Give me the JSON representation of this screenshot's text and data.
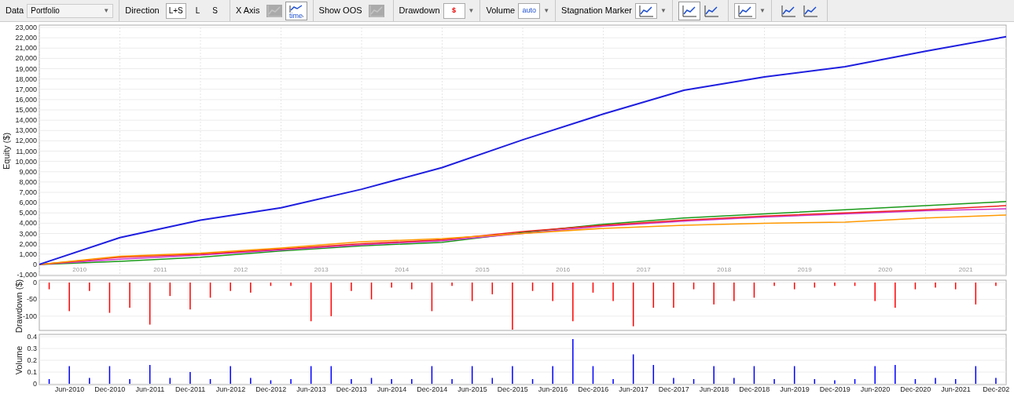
{
  "toolbar": [
    {
      "kind": "select",
      "label": "Data",
      "value": "Portfolio",
      "caret": "▼"
    },
    {
      "kind": "segmented",
      "label": "Direction",
      "options": [
        {
          "label": "L+S",
          "selected": true
        },
        {
          "label": "L",
          "selected": false
        },
        {
          "label": "S",
          "selected": false
        }
      ]
    },
    {
      "kind": "icons",
      "label": "X Axis",
      "buttons": [
        {
          "selected": false,
          "disabled": true
        },
        {
          "selected": true,
          "disabled": false,
          "text": "time"
        }
      ]
    },
    {
      "kind": "icons",
      "label": "Show OOS",
      "buttons": [
        {
          "selected": false,
          "disabled": true
        }
      ]
    },
    {
      "kind": "menu",
      "label": "Drawdown",
      "text": "$",
      "caret": "▼"
    },
    {
      "kind": "menu",
      "label": "Volume",
      "text": "auto",
      "caret": "▼"
    },
    {
      "kind": "menu",
      "label": "Stagnation Marker",
      "caret": "▼"
    },
    {
      "kind": "icons",
      "buttons": [
        {
          "selected": true,
          "disabled": false
        },
        {
          "selected": false,
          "disabled": false
        }
      ]
    },
    {
      "kind": "menu",
      "caret": "▼"
    },
    {
      "kind": "icons",
      "buttons": [
        {
          "selected": false,
          "disabled": false
        },
        {
          "selected": false,
          "disabled": false
        }
      ]
    }
  ],
  "equity": {
    "chart_data": {
      "type": "line",
      "ylabel": "Equity ($)",
      "grid": true,
      "x": [
        2010,
        2011,
        2012,
        2013,
        2014,
        2015,
        2016,
        2017,
        2018,
        2019,
        2020,
        2021,
        2022
      ],
      "xlim": [
        2010,
        2022
      ],
      "ylim": [
        -1000,
        23000
      ],
      "yticks": [
        {
          "value": -1000,
          "label": "-1,000"
        },
        0,
        {
          "value": 1000,
          "label": "1,000"
        },
        {
          "value": 2000,
          "label": "2,000"
        },
        {
          "value": 3000,
          "label": "3,000"
        },
        {
          "value": 4000,
          "label": "4,000"
        },
        {
          "value": 5000,
          "label": "5,000"
        },
        {
          "value": 6000,
          "label": "6,000"
        },
        {
          "value": 7000,
          "label": "7,000"
        },
        {
          "value": 8000,
          "label": "8,000"
        },
        {
          "value": 9000,
          "label": "9,000"
        },
        {
          "value": 10000,
          "label": "10,000"
        },
        {
          "value": 11000,
          "label": "11,000"
        },
        {
          "value": 12000,
          "label": "12,000"
        },
        {
          "value": 13000,
          "label": "13,000"
        },
        {
          "value": 14000,
          "label": "14,000"
        },
        {
          "value": 15000,
          "label": "15,000"
        },
        {
          "value": 16000,
          "label": "16,000"
        },
        {
          "value": 17000,
          "label": "17,000"
        },
        {
          "value": 18000,
          "label": "18,000"
        },
        {
          "value": 19000,
          "label": "19,000"
        },
        {
          "value": 20000,
          "label": "20,000"
        },
        {
          "value": 21000,
          "label": "21,000"
        },
        {
          "value": 22000,
          "label": "22,000"
        },
        {
          "value": 23000,
          "label": "23,000"
        }
      ],
      "xticks": [
        {
          "value": 2010.5,
          "label": "2010"
        },
        {
          "value": 2011.5,
          "label": "2011"
        },
        {
          "value": 2012.5,
          "label": "2012"
        },
        {
          "value": 2013.5,
          "label": "2013"
        },
        {
          "value": 2014.5,
          "label": "2014"
        },
        {
          "value": 2015.5,
          "label": "2015"
        },
        {
          "value": 2016.5,
          "label": "2016"
        },
        {
          "value": 2017.5,
          "label": "2017"
        },
        {
          "value": 2018.5,
          "label": "2018"
        },
        {
          "value": 2019.5,
          "label": "2019"
        },
        {
          "value": 2020.5,
          "label": "2020"
        },
        {
          "value": 2021.5,
          "label": "2021"
        }
      ],
      "series": [
        {
          "color": "#1f1fe0",
          "values": [
            0,
            2600,
            4300,
            5500,
            7300,
            9400,
            12100,
            14600,
            16900,
            18200,
            19200,
            20700,
            22100
          ]
        },
        {
          "color": "#ff9900",
          "values": [
            0,
            800,
            1100,
            1600,
            2200,
            2500,
            3000,
            3500,
            3800,
            4000,
            4100,
            4500,
            4800
          ]
        },
        {
          "color": "#ee2222",
          "values": [
            0,
            700,
            1000,
            1500,
            2000,
            2400,
            3200,
            3800,
            4300,
            4700,
            5000,
            5300,
            5700
          ]
        },
        {
          "color": "#cc33cc",
          "values": [
            0,
            500,
            900,
            1400,
            1900,
            2300,
            3000,
            3700,
            4200,
            4600,
            4900,
            5200,
            5400
          ]
        },
        {
          "color": "#1a9a1a",
          "values": [
            0,
            300,
            700,
            1300,
            1800,
            2150,
            3100,
            3900,
            4500,
            4900,
            5300,
            5700,
            6100
          ]
        }
      ]
    }
  },
  "drawdown": {
    "chart_data": {
      "type": "bar",
      "ylabel": "Drawdown ($)",
      "grid": true,
      "ylim": [
        -140,
        0
      ],
      "yticks": [
        0,
        -50,
        -100
      ],
      "categories": [
        null,
        null,
        null,
        null,
        null,
        null,
        null,
        null,
        null,
        null,
        null,
        null,
        null,
        null,
        null,
        null,
        null,
        null,
        null,
        null,
        null,
        null,
        null,
        null,
        null,
        null,
        null,
        null,
        null,
        null,
        null,
        null,
        null,
        null,
        null,
        null,
        null,
        null,
        null,
        null,
        null,
        null,
        null,
        null,
        null,
        null,
        null,
        null
      ],
      "series": [
        {
          "color": "#ff0000",
          "values": [
            -20,
            -85,
            -25,
            -90,
            -75,
            -125,
            -40,
            -80,
            -45,
            -25,
            -30,
            -10,
            -10,
            -115,
            -100,
            -25,
            -50,
            -15,
            -20,
            -85,
            -10,
            -55,
            -35,
            -140,
            -25,
            -55,
            -115,
            -30,
            -55,
            -130,
            -75,
            -75,
            -20,
            -65,
            -55,
            -45,
            -10,
            -20,
            -15,
            -10,
            -10,
            -55,
            -75,
            -20,
            -15,
            -20,
            -65,
            -10
          ]
        }
      ]
    }
  },
  "volume": {
    "chart_data": {
      "type": "bar",
      "ylabel": "Volume",
      "grid": true,
      "ylim": [
        0,
        0.4
      ],
      "yticks": [
        0,
        0.1,
        0.2,
        0.3,
        0.4
      ],
      "categories": [
        null,
        "Jun-2010",
        null,
        "Dec-2010",
        null,
        "Jun-2011",
        null,
        "Dec-2011",
        null,
        "Jun-2012",
        null,
        "Dec-2012",
        null,
        "Jun-2013",
        null,
        "Dec-2013",
        null,
        "Jun-2014",
        null,
        "Dec-2014",
        null,
        "Jun-2015",
        null,
        "Dec-2015",
        null,
        "Jun-2016",
        null,
        "Dec-2016",
        null,
        "Jun-2017",
        null,
        "Dec-2017",
        null,
        "Jun-2018",
        null,
        "Dec-2018",
        null,
        "Jun-2019",
        null,
        "Dec-2019",
        null,
        "Jun-2020",
        null,
        "Dec-2020",
        null,
        "Jun-2021",
        null,
        "Dec-202"
      ],
      "series": [
        {
          "color": "#0000ff",
          "values": [
            0.04,
            0.15,
            0.05,
            0.15,
            0.04,
            0.16,
            0.05,
            0.1,
            0.04,
            0.15,
            0.05,
            0.03,
            0.04,
            0.15,
            0.15,
            0.04,
            0.05,
            0.04,
            0.04,
            0.15,
            0.04,
            0.15,
            0.05,
            0.15,
            0.04,
            0.15,
            0.38,
            0.15,
            0.04,
            0.25,
            0.16,
            0.05,
            0.04,
            0.15,
            0.05,
            0.15,
            0.04,
            0.15,
            0.04,
            0.03,
            0.04,
            0.15,
            0.16,
            0.04,
            0.05,
            0.04,
            0.15,
            0.05
          ]
        }
      ]
    }
  }
}
